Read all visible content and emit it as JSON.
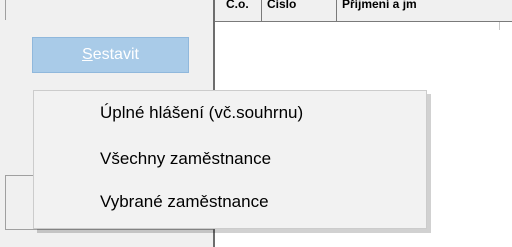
{
  "grid": {
    "columns": [
      "Č.o.",
      "Číslo",
      "Příjmení a jm"
    ]
  },
  "toolbar": {
    "sestavit_accel": "S",
    "sestavit_rest": "estavit"
  },
  "menu": {
    "items": [
      {
        "label": "Úplné hlášení (vč.souhrnu)"
      },
      {
        "label": "Všechny zaměstnance"
      },
      {
        "label": "Vybrané zaměstnance"
      }
    ]
  }
}
